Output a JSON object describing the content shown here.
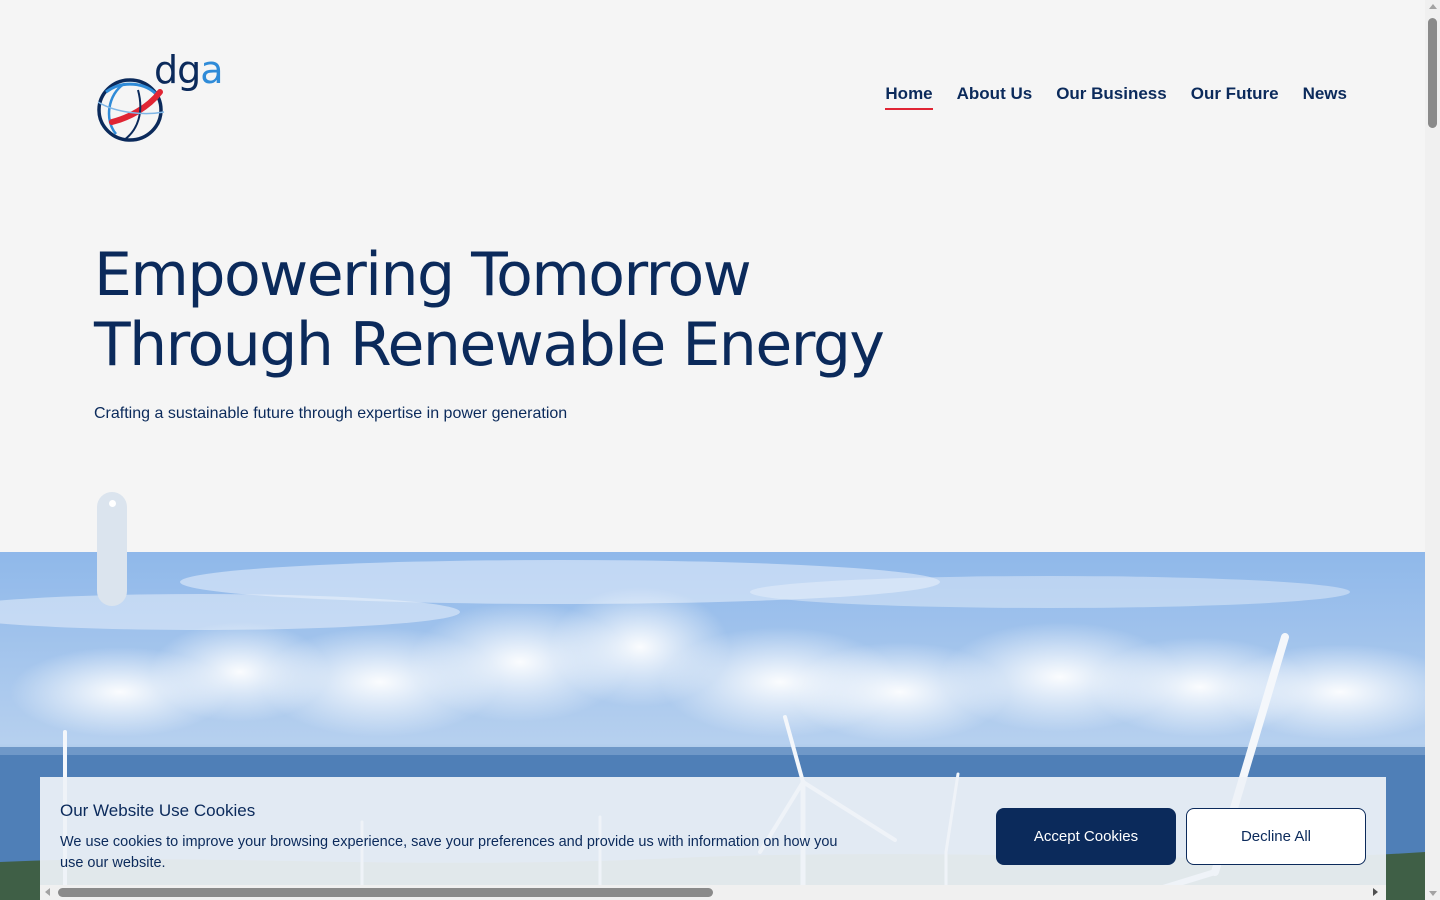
{
  "brand": {
    "logo_letters": [
      "d",
      "g",
      "a"
    ]
  },
  "nav": {
    "items": [
      {
        "label": "Home",
        "active": true
      },
      {
        "label": "About Us"
      },
      {
        "label": "Our Business"
      },
      {
        "label": "Our Future"
      },
      {
        "label": "News"
      }
    ]
  },
  "hero": {
    "title_line1": "Empowering Tomorrow",
    "title_line2": "Through Renewable Energy",
    "subtitle": "Crafting a sustainable future through expertise in power generation"
  },
  "cookie": {
    "title": "Our Website Use Cookies",
    "text": "We use cookies to improve your browsing experience, save your preferences and provide us with information on how you use our website.",
    "accept_label": "Accept Cookies",
    "decline_label": "Decline All"
  },
  "colors": {
    "brand_navy": "#0b2a5b",
    "accent_red": "#e02534",
    "logo_blue": "#2f8bd8",
    "background": "#f5f5f5"
  }
}
